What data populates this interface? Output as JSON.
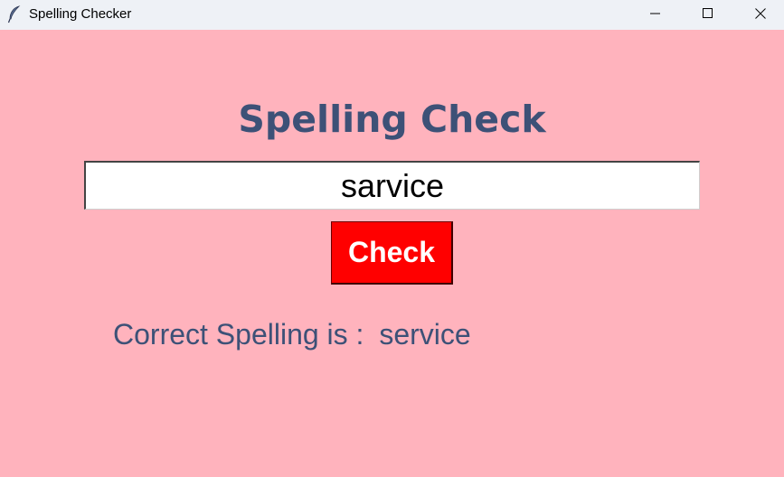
{
  "window": {
    "title": "Spelling Checker",
    "controls": {
      "minimize": "minimize-icon",
      "maximize": "maximize-icon",
      "close": "close-icon"
    },
    "app_icon": "feather-icon"
  },
  "main": {
    "heading": "Spelling Check",
    "input_value": "sarvice",
    "check_label": "Check",
    "result_label": "Correct Spelling is :",
    "result_value": "service"
  },
  "colors": {
    "background": "#ffb3bd",
    "heading_text": "#3d5177",
    "button_bg": "#ff0000",
    "button_text": "#ffffff"
  }
}
